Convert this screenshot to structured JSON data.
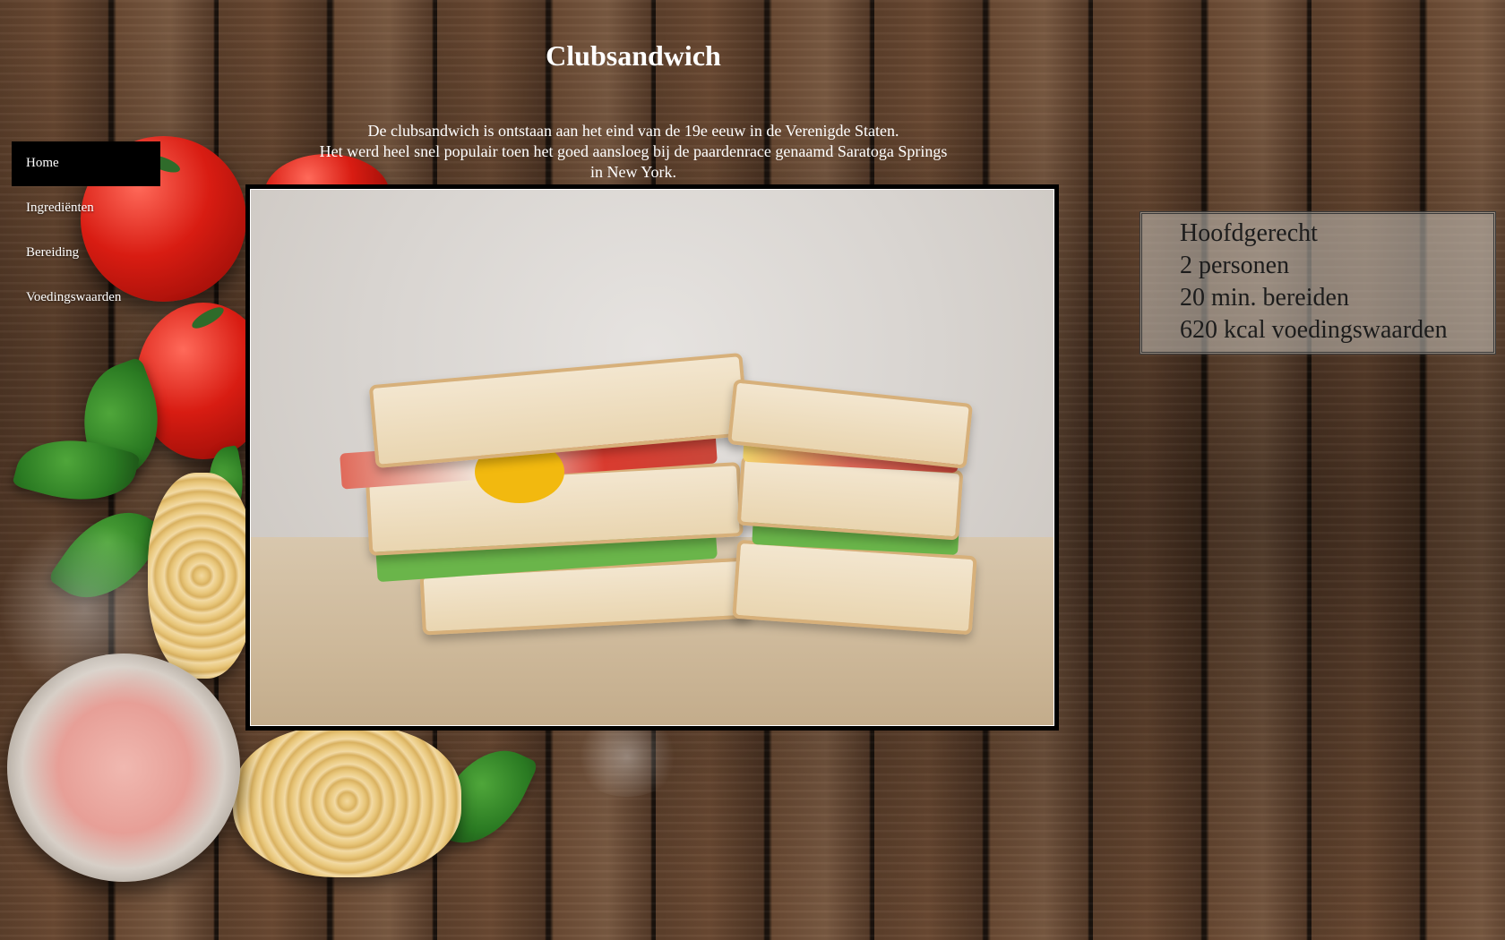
{
  "page": {
    "title": "Clubsandwich",
    "intro_lines": [
      "De clubsandwich is ontstaan aan het eind van de 19e eeuw in de Verenigde Staten.",
      "Het werd heel snel populair toen het goed aansloeg bij de paardenrace genaamd Saratoga Springs",
      "in New York."
    ]
  },
  "nav": {
    "items": [
      {
        "label": "Home",
        "active": true
      },
      {
        "label": "Ingrediënten",
        "active": false
      },
      {
        "label": "Bereiding",
        "active": false
      },
      {
        "label": "Voedingswaarden",
        "active": false
      }
    ]
  },
  "info": {
    "course": "Hoofdgerecht",
    "servings": "2 personen",
    "prep_time": "20 min. bereiden",
    "calories": "620 kcal voedingswaarden"
  },
  "colors": {
    "nav_active_bg": "#000000",
    "text": "#ffffff",
    "info_text": "#1c1c1c"
  }
}
